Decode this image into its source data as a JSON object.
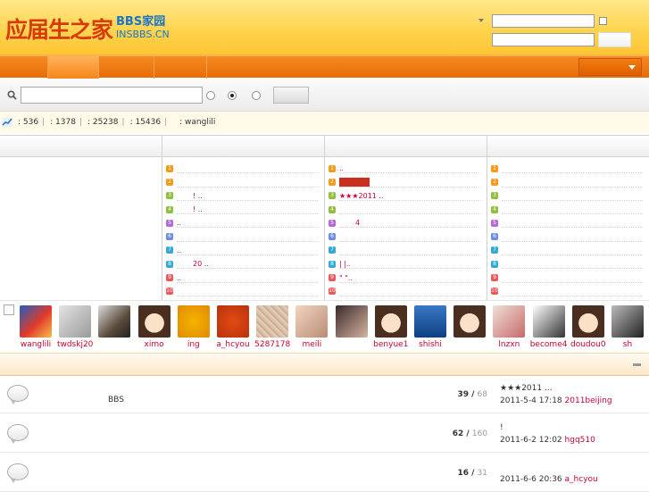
{
  "header": {
    "logo_text": "应届生之家",
    "logo_bbs": "BBS家园",
    "logo_domain": "INSBBS.CN"
  },
  "stats": {
    "items": [
      ": 536",
      ": 1378",
      ": 25238",
      ": 15436",
      ": wanglili"
    ]
  },
  "columns": [
    {
      "rows": []
    },
    {
      "rows": [
        "",
        "",
        "!      ..",
        "!      ..",
        "..",
        "",
        "..",
        "20    ..",
        "..",
        ""
      ]
    },
    {
      "rows": [
        "..",
        "",
        "★★★2011       ..",
        "",
        "4",
        "",
        "",
        "|   |..",
        "\"  \"..",
        ""
      ]
    },
    {
      "rows": [
        "",
        "",
        "",
        "",
        "",
        "",
        "",
        "",
        "",
        ""
      ]
    }
  ],
  "members": [
    "wanglili",
    "twdskj20",
    "",
    "ximo",
    "ing",
    "a_hcyou",
    "5287178",
    "meili",
    "",
    "benyue1",
    "shishi",
    "",
    "lnzxn",
    "become4",
    "doudou0",
    "sh"
  ],
  "threads": [
    {
      "title": "BBS",
      "replies": "39",
      "views": "68",
      "last_title": "★★★2011        ...",
      "last_time": "2011-5-4 17:18",
      "last_user": "2011beijing"
    },
    {
      "title": "",
      "replies": "62",
      "views": "160",
      "last_title": "!        ",
      "last_time": "2011-6-2 12:02",
      "last_user": "hgq510"
    },
    {
      "title": "",
      "replies": "16",
      "views": "31",
      "last_title": "",
      "last_time": "2011-6-6 20:36",
      "last_user": "a_hcyou"
    }
  ],
  "colors": {
    "brand": "#e96c05",
    "accent": "#cc0033"
  }
}
